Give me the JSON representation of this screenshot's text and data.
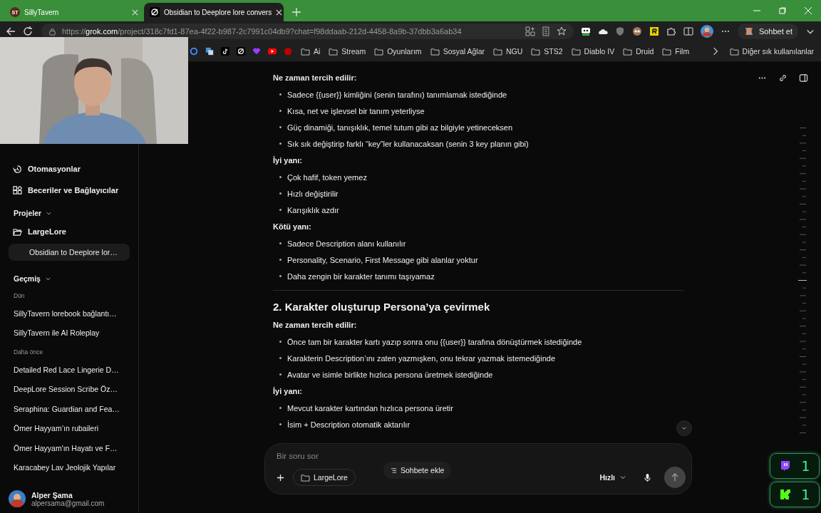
{
  "tabs": [
    {
      "badge": "ST",
      "label": "SillyTavern",
      "selected": false
    },
    {
      "label": "Obsidian to Deeplore lore convers",
      "selected": true
    }
  ],
  "address": {
    "scheme": "https://",
    "host": "grok.com",
    "path": "/project/318c7fd1-87ea-4f22-b987-2c7991c04db9?chat=f98ddaab-212d-4458-8a9b-37dbb3a6ab34"
  },
  "copilot_label": "Sohbet et",
  "bookmarks": [
    "Ai",
    "Stream",
    "Oyunlarım",
    "Sosyal Ağlar",
    "NGU",
    "STS2",
    "Diablo IV",
    "Druid",
    "Film"
  ],
  "other_bookmarks": "Diğer sık kullanılanlar",
  "sidebar": {
    "nav": [
      {
        "label": "Otomasyonlar",
        "kind": "automation"
      },
      {
        "label": "Beceriler ve Bağlayıcılar",
        "kind": "skills"
      }
    ],
    "projects": {
      "heading": "Projeler",
      "expanded": true,
      "items": [
        {
          "label": "LargeLore",
          "children": [
            {
              "label": "Obsidian to Deeplore lor…",
              "selected": true
            }
          ]
        }
      ]
    },
    "history": {
      "heading": "Geçmiş",
      "expanded": true,
      "groups": [
        {
          "label": "Dün",
          "items": [
            "SillyTavern lorebook bağlantı…",
            "SillyTavern ile AI Roleplay"
          ]
        },
        {
          "label": "Daha önce",
          "items": [
            "Detailed Red Lace Lingerie D…",
            "DeepLore Session Scribe Öz…",
            "Seraphina: Guardian and Fea…",
            "Ömer Hayyam’ın rubaileri",
            "Ömer Hayyam'ın Hayatı ve F…",
            "Karacabey Lav Jeolojik Yapılar"
          ]
        }
      ]
    },
    "user": {
      "name": "Alper Şama",
      "email": "alpersama@gmail.com"
    }
  },
  "content": [
    {
      "kind": "label",
      "text": "Ne zaman tercih edilir:"
    },
    {
      "kind": "list",
      "items": [
        "Sadece {{user}} kimliğini (senin tarafını) tanımlamak istediğinde",
        "Kısa, net ve işlevsel bir tanım yeterliyse",
        "Güç dinamiği, tanışıklık, temel tutum gibi az bilgiyle yetineceksen",
        "Sık sık değiştirip farklı “key”ler kullanacaksan (senin 3 key planın gibi)"
      ]
    },
    {
      "kind": "label",
      "text": "İyi yanı:"
    },
    {
      "kind": "list",
      "items": [
        "Çok hafif, token yemez",
        "Hızlı değiştirilir",
        "Karışıklık azdır"
      ]
    },
    {
      "kind": "label",
      "text": "Kötü yanı:"
    },
    {
      "kind": "list",
      "items": [
        "Sadece Description alanı kullanılır",
        "Personality, Scenario, First Message gibi alanlar yoktur",
        "Daha zengin bir karakter tanımı taşıyamaz"
      ]
    },
    {
      "kind": "divider"
    },
    {
      "kind": "heading",
      "text": "2. Karakter oluşturup Persona’ya çevirmek"
    },
    {
      "kind": "label",
      "text": "Ne zaman tercih edilir:"
    },
    {
      "kind": "list",
      "items": [
        "Önce tam bir karakter kartı yazıp sonra onu {{user}} tarafına dönüştürmek istediğinde",
        "Karakterin Description’ını zaten yazmışken, onu tekrar yazmak istemediğinde",
        "Avatar ve isimle birlikte hızlıca persona üretmek istediğinde"
      ]
    },
    {
      "kind": "label",
      "text": "İyi yanı:"
    },
    {
      "kind": "list",
      "items": [
        "Mevcut karakter kartından hızlıca persona üretir",
        "İsim + Description otomatik aktarılır"
      ]
    }
  ],
  "composer": {
    "placeholder": "Bir soru sor",
    "add_to_chat": "Sohbete ekle",
    "project": "LargeLore",
    "model": "Hızlı"
  },
  "widgets": [
    {
      "kind": "twitch",
      "count": "1"
    },
    {
      "kind": "kick",
      "count": "1"
    }
  ]
}
